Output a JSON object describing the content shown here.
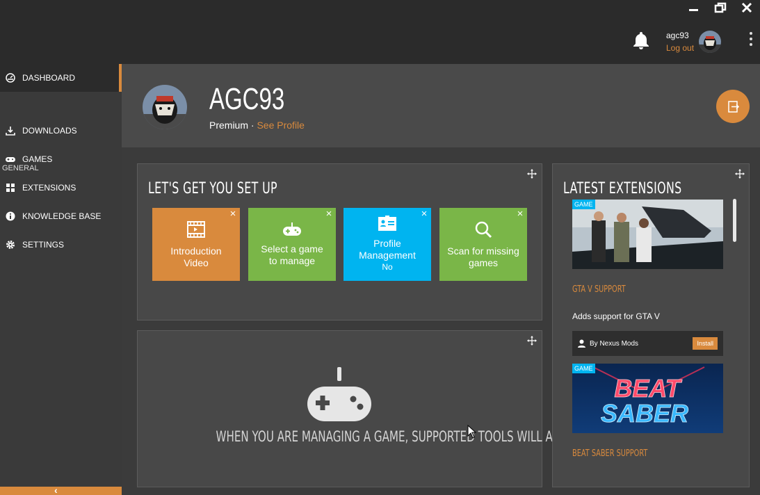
{
  "titlebar": {
    "username": "agc93",
    "logout_label": "Log out"
  },
  "sidebar": {
    "items": [
      {
        "label": "DASHBOARD",
        "icon": "dashboard-icon",
        "active": true
      },
      {
        "label": "DOWNLOADS",
        "icon": "download-icon"
      },
      {
        "label": "GAMES",
        "icon": "gamepad-icon"
      },
      {
        "label": "EXTENSIONS",
        "icon": "extensions-icon"
      },
      {
        "label": "KNOWLEDGE BASE",
        "icon": "info-icon"
      },
      {
        "label": "SETTINGS",
        "icon": "gear-icon"
      }
    ],
    "section_general": "GENERAL"
  },
  "profile": {
    "name": "AGC93",
    "tier": "Premium",
    "separator": " · ",
    "see_profile": "See Profile"
  },
  "setup": {
    "title": "LET'S GET YOU SET UP",
    "tiles": [
      {
        "label": "Introduction Video",
        "color": "#d98a3d",
        "icon": "video-icon"
      },
      {
        "label": "Select a game to manage",
        "color": "#7ab648",
        "icon": "gamepad-icon"
      },
      {
        "label": "Profile Management",
        "sub": "No",
        "color": "#00b4f0",
        "icon": "id-card-icon"
      },
      {
        "label": "Scan for missing games",
        "color": "#7ab648",
        "icon": "search-icon"
      }
    ]
  },
  "tools": {
    "message": "WHEN YOU ARE MANAGING A GAME, SUPPORTED TOOLS WILL APPEAR HERE"
  },
  "extensions": {
    "title": "LATEST EXTENSIONS",
    "items": [
      {
        "badge": "GAME",
        "title": "GTA V SUPPORT",
        "description": "Adds support for GTA V",
        "author": "By Nexus Mods",
        "install_label": "Install"
      },
      {
        "badge": "GAME",
        "title": "BEAT SABER SUPPORT",
        "image_text_line1": "BEAT",
        "image_text_line2": "SABER"
      }
    ]
  },
  "colors": {
    "accent": "#d98a3d",
    "green": "#7ab648",
    "blue": "#00b4f0"
  }
}
